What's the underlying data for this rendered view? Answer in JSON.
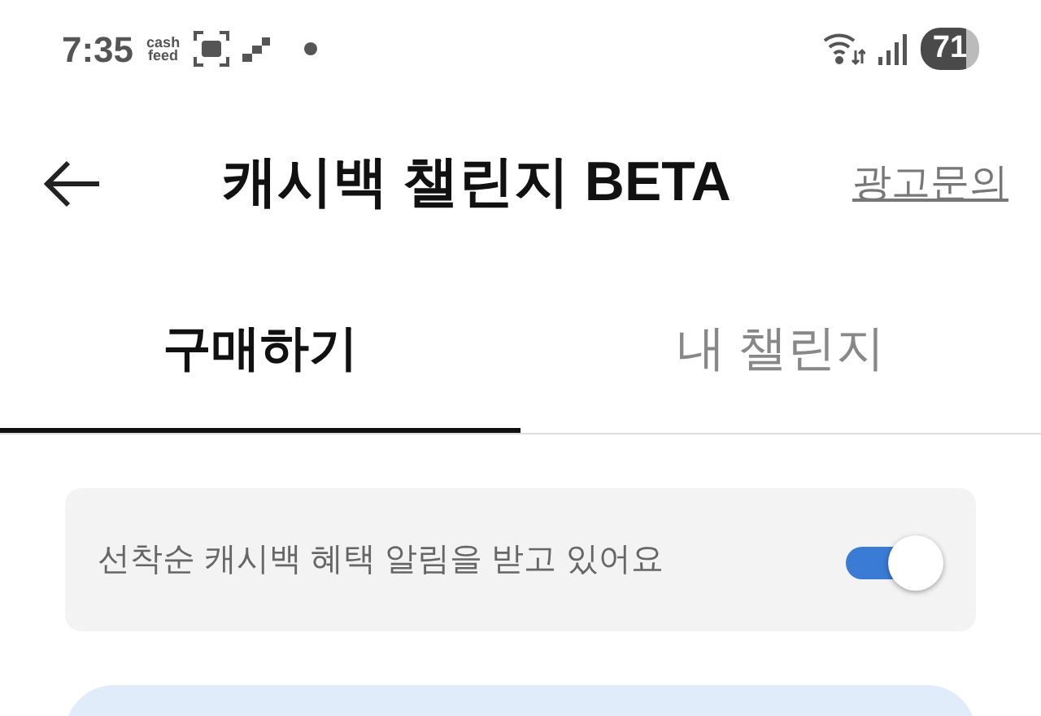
{
  "status_bar": {
    "time": "7:35",
    "app_icon_text": [
      "cash",
      "feed"
    ],
    "battery": "71"
  },
  "header": {
    "title": "캐시백 챌린지 BETA",
    "action": "광고문의"
  },
  "tabs": [
    {
      "label": "구매하기",
      "selected": true
    },
    {
      "label": "내 챌린지",
      "selected": false
    }
  ],
  "notice": {
    "text": "선착순 캐시백 혜택 알림을 받고 있어요",
    "on": true
  }
}
